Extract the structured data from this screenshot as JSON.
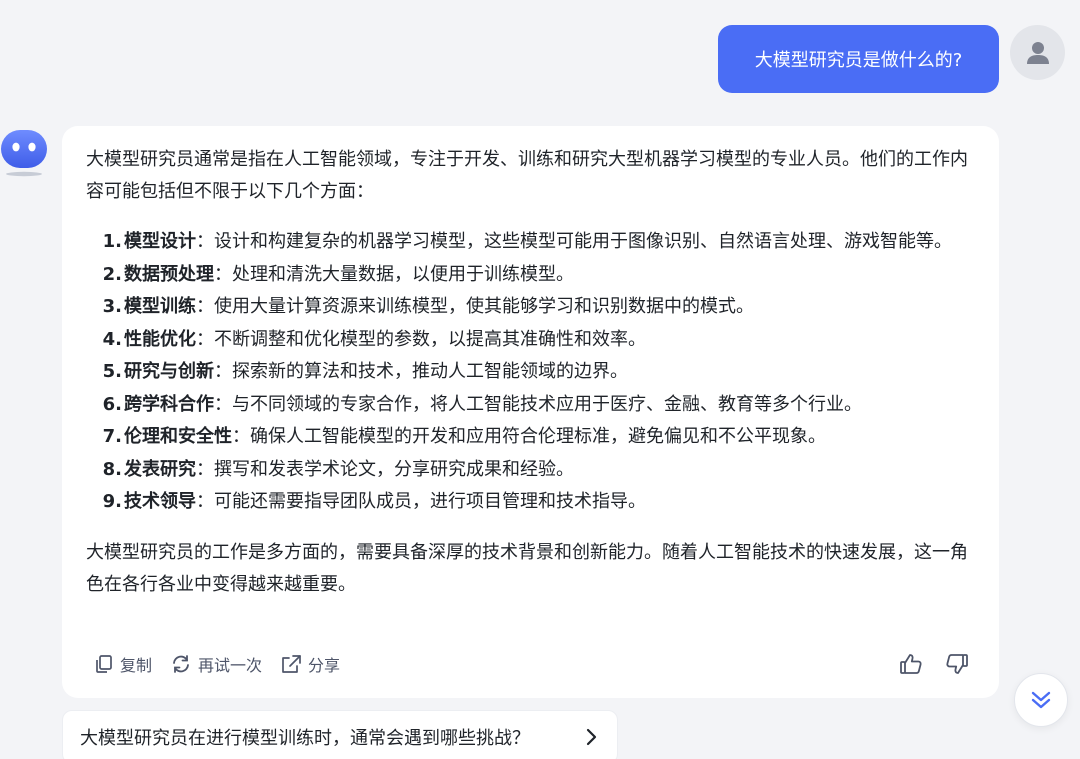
{
  "user": {
    "question": "大模型研究员是做什么的?"
  },
  "answer": {
    "intro": "大模型研究员通常是指在人工智能领域，专注于开发、训练和研究大型机器学习模型的专业人员。他们的工作内容可能包括但不限于以下几个方面：",
    "items": [
      {
        "num": "1.",
        "term": "模型设计",
        "desc": "：设计和构建复杂的机器学习模型，这些模型可能用于图像识别、自然语言处理、游戏智能等。"
      },
      {
        "num": "2.",
        "term": "数据预处理",
        "desc": "：处理和清洗大量数据，以便用于训练模型。"
      },
      {
        "num": "3.",
        "term": "模型训练",
        "desc": "：使用大量计算资源来训练模型，使其能够学习和识别数据中的模式。"
      },
      {
        "num": "4.",
        "term": "性能优化",
        "desc": "：不断调整和优化模型的参数，以提高其准确性和效率。"
      },
      {
        "num": "5.",
        "term": "研究与创新",
        "desc": "：探索新的算法和技术，推动人工智能领域的边界。"
      },
      {
        "num": "6.",
        "term": "跨学科合作",
        "desc": "：与不同领域的专家合作，将人工智能技术应用于医疗、金融、教育等多个行业。"
      },
      {
        "num": "7.",
        "term": "伦理和安全性",
        "desc": "：确保人工智能模型的开发和应用符合伦理标准，避免偏见和不公平现象。"
      },
      {
        "num": "8.",
        "term": "发表研究",
        "desc": "：撰写和发表学术论文，分享研究成果和经验。"
      },
      {
        "num": "9.",
        "term": "技术领导",
        "desc": "：可能还需要指导团队成员，进行项目管理和技术指导。"
      }
    ],
    "conclusion": "大模型研究员的工作是多方面的，需要具备深厚的技术背景和创新能力。随着人工智能技术的快速发展，这一角色在各行各业中变得越来越重要。"
  },
  "actions": {
    "copy": "复制",
    "retry": "再试一次",
    "share": "分享"
  },
  "suggestion": {
    "text": "大模型研究员在进行模型训练时，通常会遇到哪些挑战？"
  },
  "colors": {
    "accent": "#4a6df5",
    "background": "#f3f4f7",
    "card": "#ffffff"
  }
}
